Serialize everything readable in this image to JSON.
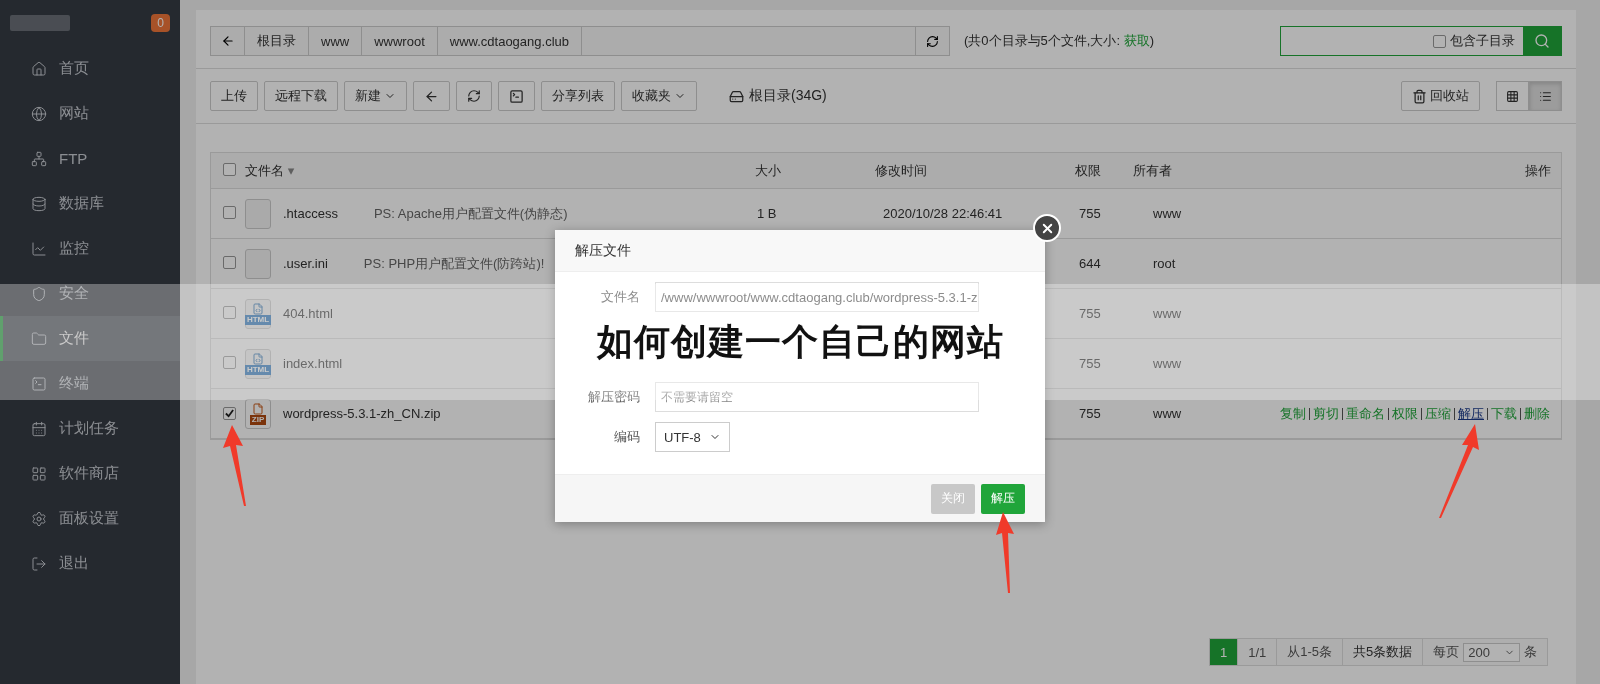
{
  "sidebar": {
    "badge": "0",
    "items": [
      {
        "label": "首页",
        "selected": false
      },
      {
        "label": "网站",
        "selected": false
      },
      {
        "label": "FTP",
        "selected": false
      },
      {
        "label": "数据库",
        "selected": false
      },
      {
        "label": "监控",
        "selected": false
      },
      {
        "label": "安全",
        "selected": false
      },
      {
        "label": "文件",
        "selected": true
      },
      {
        "label": "终端",
        "selected": false
      },
      {
        "label": "计划任务",
        "selected": false
      },
      {
        "label": "软件商店",
        "selected": false
      },
      {
        "label": "面板设置",
        "selected": false
      },
      {
        "label": "退出",
        "selected": false
      }
    ]
  },
  "path_bar": {
    "crumbs": [
      "根目录",
      "www",
      "wwwroot",
      "www.cdtaogang.club"
    ],
    "summary_prefix": "(共0个目录与5个文件,大小: ",
    "summary_link": "获取",
    "summary_suffix": ")"
  },
  "search": {
    "subdir_label": "包含子目录",
    "subdir_checked": false
  },
  "toolbar": {
    "buttons": [
      {
        "kind": "text",
        "label": "上传"
      },
      {
        "kind": "text",
        "label": "远程下载"
      },
      {
        "kind": "dropdown",
        "label": "新建"
      },
      {
        "kind": "back"
      },
      {
        "kind": "refresh"
      },
      {
        "kind": "terminal"
      },
      {
        "kind": "text",
        "label": "分享列表"
      },
      {
        "kind": "dropdown",
        "label": "收藏夹"
      }
    ],
    "disk": "根目录(34G)",
    "recycle": "回收站",
    "views": [
      {
        "kind": "grid",
        "selected": false
      },
      {
        "kind": "list",
        "selected": true
      }
    ]
  },
  "table": {
    "columns": [
      "文件名",
      "大小",
      "修改时间",
      "权限",
      "所有者",
      "操作"
    ],
    "sort_indicator": "▾",
    "all_checked": false,
    "rows": [
      {
        "kind": "file",
        "name": ".htaccess",
        "note": "PS: Apache用户配置文件(伪静态)",
        "size": "1 B",
        "modified": "2020/10/28 22:46:41",
        "permission": "755",
        "owner": "www",
        "checked": false
      },
      {
        "kind": "file",
        "name": ".user.ini",
        "note": "PS: PHP用户配置文件(防跨站)!",
        "permission": "644",
        "owner": "root",
        "checked": false
      },
      {
        "kind": "html",
        "badge": "HTML",
        "name": "404.html",
        "permission": "755",
        "owner": "www",
        "checked": false
      },
      {
        "kind": "html",
        "badge": "HTML",
        "name": "index.html",
        "permission": "755",
        "owner": "www",
        "checked": false
      },
      {
        "kind": "zip",
        "badge": "ZIP",
        "name": "wordpress-5.3.1-zh_CN.zip",
        "permission": "755",
        "owner": "www",
        "checked": true,
        "actions": [
          {
            "label": "复制",
            "hovered": false
          },
          {
            "label": "剪切",
            "hovered": false
          },
          {
            "label": "重命名",
            "hovered": false
          },
          {
            "label": "权限",
            "hovered": false
          },
          {
            "label": "压缩",
            "hovered": false
          },
          {
            "label": "解压",
            "hovered": true
          },
          {
            "label": "下载",
            "hovered": false
          },
          {
            "label": "删除",
            "hovered": false
          }
        ]
      }
    ]
  },
  "pagination": {
    "current": "1",
    "pages": "1/1",
    "range": "从1-5条",
    "total": "共5条数据",
    "per_page_label": "每页",
    "per_page": "200",
    "unit": "条"
  },
  "dialog": {
    "title": "解压文件",
    "fields": [
      {
        "kind": "text",
        "label": "文件名",
        "value": "/www/wwwroot/www.cdtaogang.club/wordpress-5.3.1-z"
      },
      {
        "kind": "text",
        "label": "解压密码",
        "placeholder": "不需要请留空"
      },
      {
        "kind": "select",
        "label": "编码",
        "value": "UTF-8"
      }
    ],
    "buttons": [
      {
        "label": "关闭",
        "primary": false
      },
      {
        "label": "解压",
        "primary": true
      }
    ]
  },
  "banner_title": "如何创建一个自己的网站"
}
